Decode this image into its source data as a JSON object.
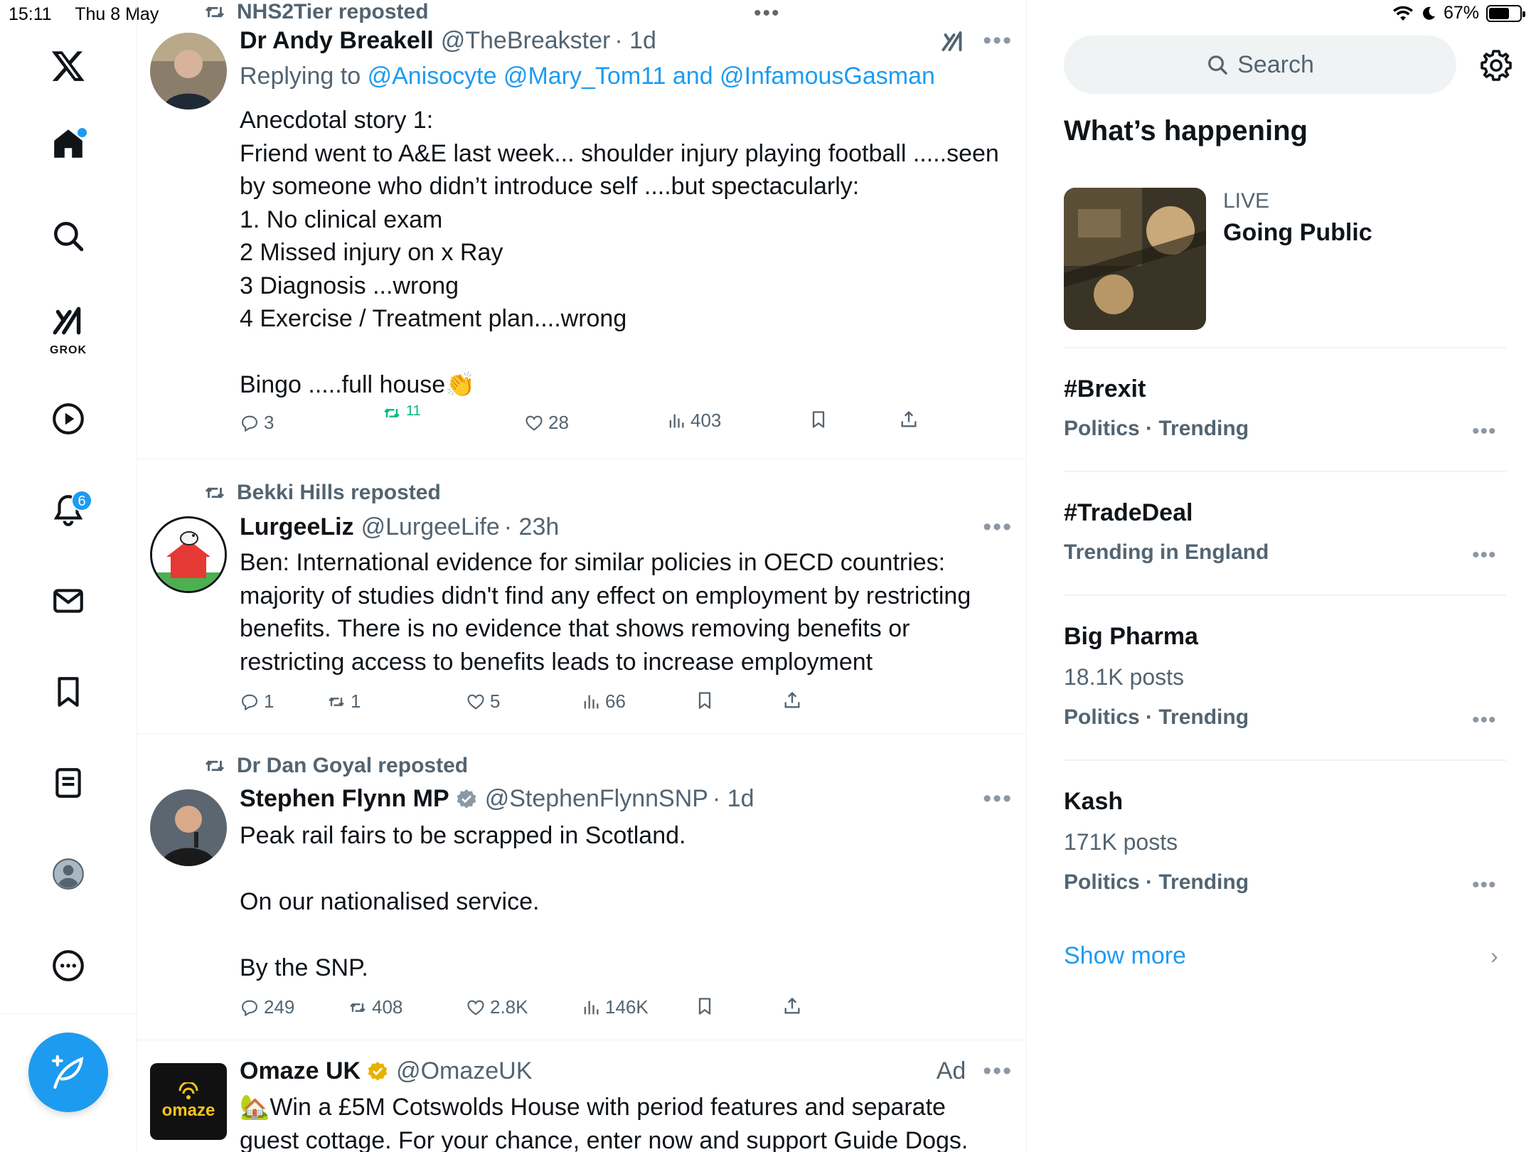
{
  "status_bar": {
    "time": "15:11",
    "date": "Thu 8 May",
    "battery": "67%",
    "battery_level": 0.67
  },
  "sidebar": {
    "notifications_badge": "6",
    "grok_label": "GROK",
    "items": [
      "x-logo",
      "home",
      "explore",
      "grok",
      "videos",
      "notifications",
      "messages",
      "bookmarks",
      "lists",
      "profile",
      "more"
    ]
  },
  "feed": {
    "posts": [
      {
        "repost_by": "NHS2Tier reposted",
        "name": "Dr Andy Breakell",
        "handle": "@TheBreakster",
        "time": "· 1d",
        "replying_prefix": "Replying to",
        "replying_mentions": "@Anisocyte @Mary_Tom11 and @InfamousGasman",
        "text": "Anecdotal story 1:\nFriend went to A&E last week... shoulder injury playing football .....seen by someone who didn’t introduce self ....but spectacularly:\n1. No clinical exam\n2 Missed injury on x Ray\n3 Diagnosis ...wrong\n4 Exercise / Treatment plan....wrong\n\nBingo .....full house👏",
        "replies": "3",
        "reposts": "11",
        "likes": "28",
        "views": "403"
      },
      {
        "repost_by": "Bekki Hills reposted",
        "name": "LurgeeLiz",
        "handle": "@LurgeeLife",
        "time": "· 23h",
        "text": "Ben: International evidence for similar policies in OECD countries: majority of studies didn't find any effect on employment by restricting benefits. There is no evidence that shows removing benefits or restricting access to benefits leads to increase employment",
        "replies": "1",
        "reposts": "1",
        "likes": "5",
        "views": "66"
      },
      {
        "repost_by": "Dr Dan Goyal reposted",
        "name": "Stephen Flynn MP",
        "handle": "@StephenFlynnSNP",
        "time": "· 1d",
        "text": "Peak rail fairs to be scrapped in Scotland.\n\nOn our nationalised service.\n\nBy the SNP.",
        "replies": "249",
        "reposts": "408",
        "likes": "2.8K",
        "views": "146K"
      },
      {
        "name": "Omaze UK",
        "handle": "@OmazeUK",
        "ad_label": "Ad",
        "avatar_text": "omaze",
        "text": "🏡Win a £5M Cotswolds House with period features and separate guest cottage. For your chance, enter now and support Guide Dogs."
      }
    ]
  },
  "right": {
    "search_placeholder": "Search",
    "section_title": "What’s happening",
    "live": {
      "tag": "LIVE",
      "title": "Going Public"
    },
    "trends": [
      {
        "name": "#Brexit",
        "posts": "",
        "meta": "Politics · Trending"
      },
      {
        "name": "#TradeDeal",
        "posts": "",
        "meta": "Trending in England"
      },
      {
        "name": "Big Pharma",
        "posts": "18.1K posts",
        "meta": "Politics · Trending"
      },
      {
        "name": "Kash",
        "posts": "171K posts",
        "meta": "Politics · Trending"
      }
    ],
    "show_more": "Show more"
  },
  "colors": {
    "accent": "#1d9bf0",
    "secondary_text": "#536471",
    "repost_active": "#00ba7c",
    "verified_blue": "#1d9bf0",
    "verified_gold": "#e8b100"
  }
}
